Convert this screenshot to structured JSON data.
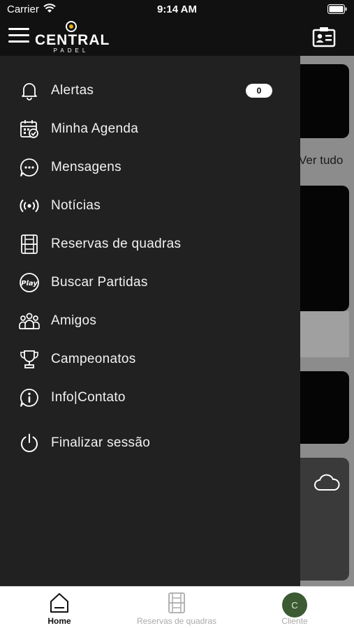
{
  "status_bar": {
    "carrier": "Carrier",
    "time": "9:14 AM"
  },
  "app": {
    "brand": "CENTRAL",
    "brand_sub": "PADEL"
  },
  "background": {
    "ver_tudo": "Ver tudo"
  },
  "menu": {
    "items": [
      {
        "label": "Alertas",
        "icon": "bell-icon",
        "badge": "0"
      },
      {
        "label": "Minha Agenda",
        "icon": "calendar-check-icon"
      },
      {
        "label": "Mensagens",
        "icon": "chat-bubble-icon"
      },
      {
        "label": "Notícias",
        "icon": "broadcast-icon"
      },
      {
        "label": "Reservas de quadras",
        "icon": "court-icon"
      },
      {
        "label": "Buscar Partidas",
        "icon": "play-icon"
      },
      {
        "label": "Amigos",
        "icon": "friends-icon"
      },
      {
        "label": "Campeonatos",
        "icon": "trophy-icon"
      },
      {
        "label": "Info|Contato",
        "icon": "info-chat-icon"
      },
      {
        "label": "Finalizar sessão",
        "icon": "power-icon"
      }
    ]
  },
  "tabs": [
    {
      "label": "Home",
      "icon": "home-icon",
      "active": true
    },
    {
      "label": "Reservas de quadras",
      "icon": "court-icon",
      "active": false
    },
    {
      "label": "Cliente",
      "icon": "avatar",
      "avatar_initial": "C",
      "active": false
    }
  ],
  "colors": {
    "drawer_bg": "#212121",
    "avatar_bg": "#3d5b33",
    "logo_accent": "#e7b10a"
  }
}
